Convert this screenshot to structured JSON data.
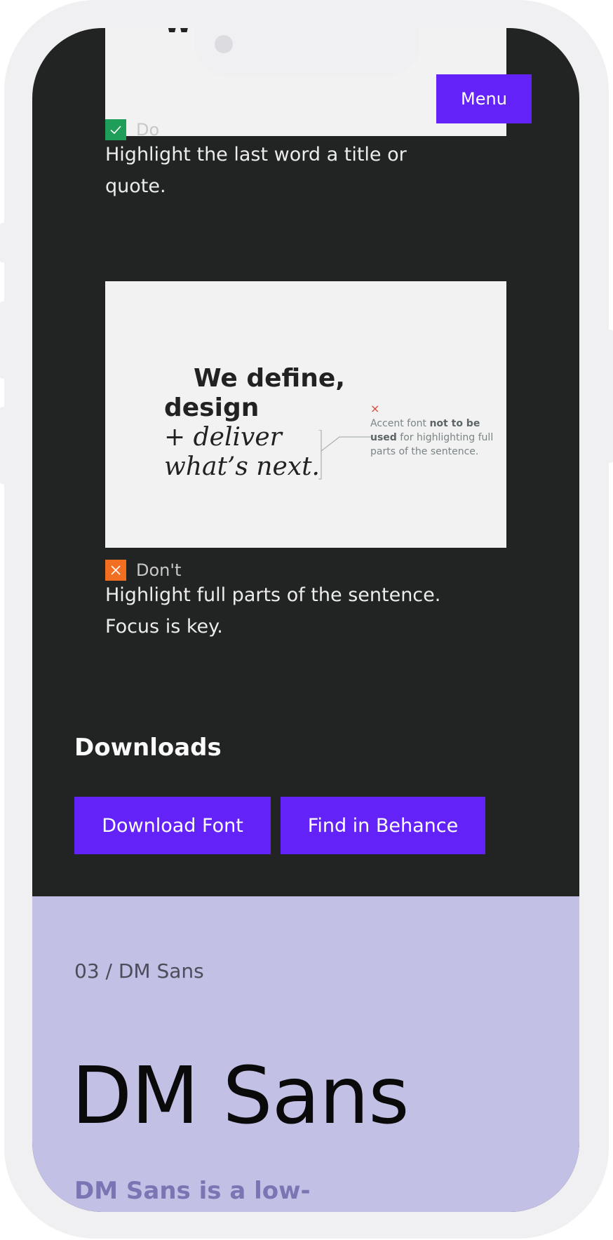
{
  "header": {
    "menu_label": "Menu"
  },
  "top_card": {
    "partial_text": "W"
  },
  "do_tag": {
    "label": "Do",
    "color": "#1e9e58"
  },
  "do_text": "Highlight the last word a title or quote.",
  "dont_card": {
    "line1": "We define,",
    "line2": "design",
    "line3_prefix": "+",
    "line3": "deliver",
    "line4": "what’s next.",
    "note_x": "×",
    "note_before": "Accent font ",
    "note_bold": "not to be used",
    "note_after": " for highlighting full parts of the sentence."
  },
  "dont_tag": {
    "label": "Don't",
    "color": "#f26e21"
  },
  "dont_text": "Highlight full parts of the sentence. Focus is key.",
  "downloads": {
    "title": "Downloads",
    "download_font": "Download Font",
    "find_behance": "Find in Behance"
  },
  "font_section": {
    "breadcrumb": "03 / DM Sans",
    "title": "DM Sans",
    "intro": "DM Sans is a low-"
  },
  "colors": {
    "accent": "#6322f7",
    "dark_bg": "#222323",
    "lavender": "#c2c0e5"
  }
}
